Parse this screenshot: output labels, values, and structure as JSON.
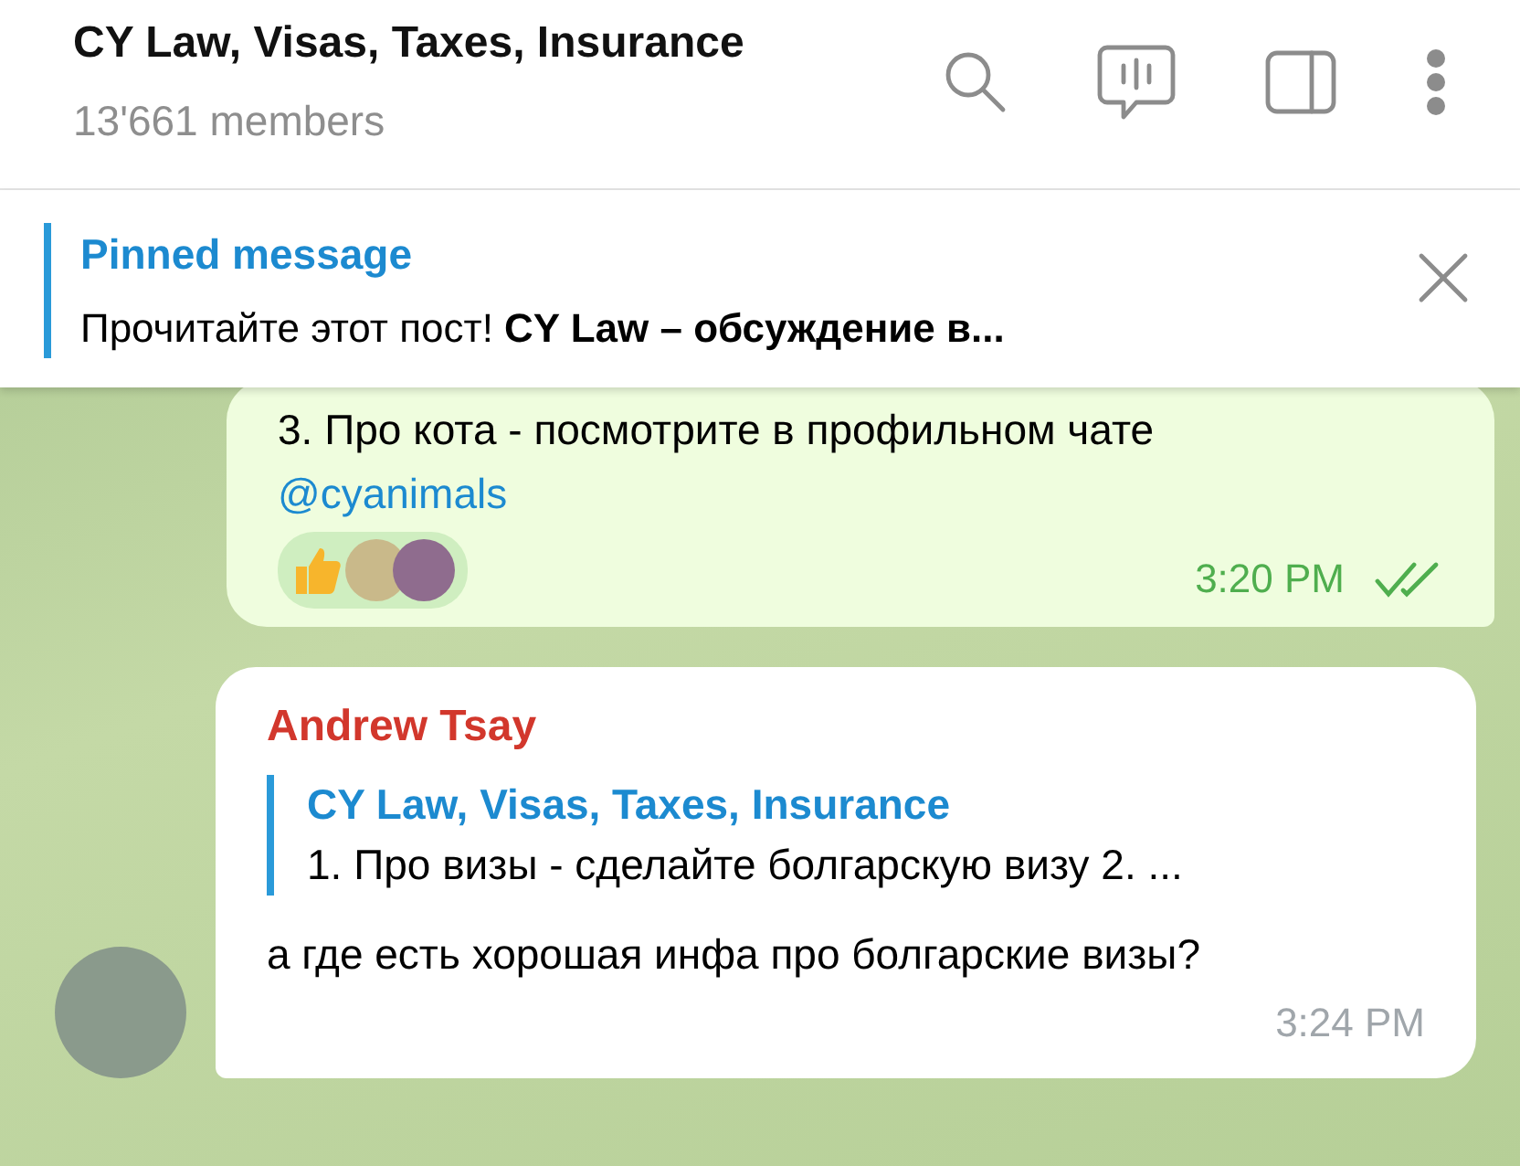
{
  "header": {
    "title": "CY Law, Visas, Taxes, Insurance",
    "subtitle": "13'661 members"
  },
  "pinned": {
    "label": "Pinned message",
    "text": "Прочитайте этот пост!  **CY Law – обсуждение в...**"
  },
  "messages": [
    {
      "kind": "outgoing",
      "lines": [
        "3. Про кота - посмотрите в профильном чате"
      ],
      "link": "@cyanimals",
      "time": "3:20 PM",
      "read": true,
      "has_reactions": true
    },
    {
      "kind": "incoming",
      "author": "Andrew Tsay",
      "reply": {
        "title": "CY Law, Visas, Taxes, Insurance",
        "text": "1. Про визы - сделайте болгарскую визу 2. ..."
      },
      "lines": [
        "а где есть хорошая инфа про болгарские визы?"
      ],
      "time": "3:24 PM"
    }
  ]
}
